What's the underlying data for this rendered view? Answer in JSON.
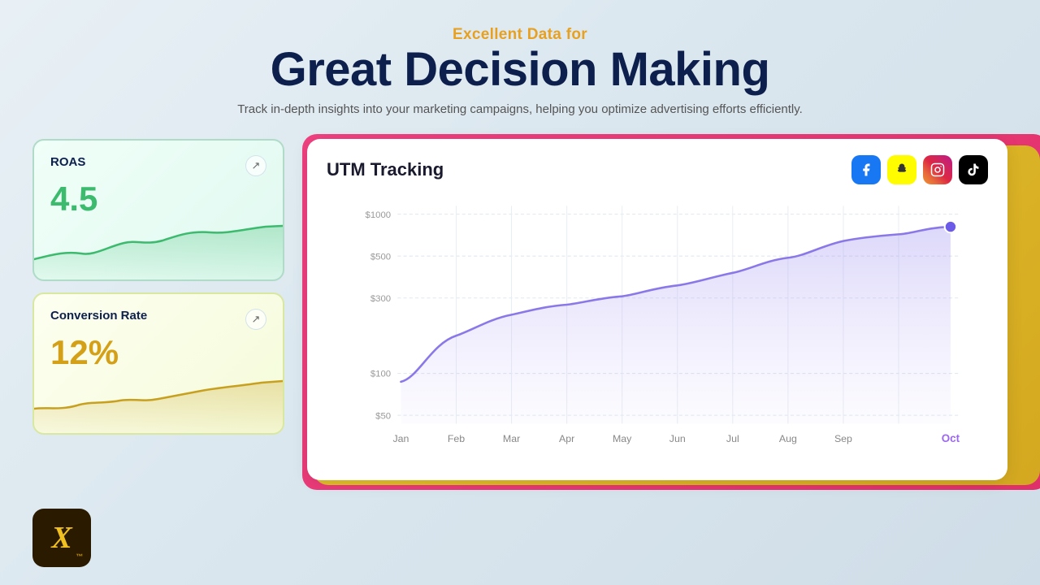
{
  "header": {
    "subtitle": "Excellent Data for",
    "title": "Great Decision Making",
    "description": "Track in-depth insights into your marketing campaigns, helping you optimize advertising efforts efficiently."
  },
  "roas_card": {
    "label": "ROAS",
    "value": "4.5",
    "arrow_label": "↗"
  },
  "conversion_card": {
    "label": "Conversion Rate",
    "value": "12%",
    "arrow_label": "↗"
  },
  "utm_card": {
    "title": "UTM Tracking",
    "social_icons": [
      "facebook",
      "snapchat",
      "instagram",
      "tiktok"
    ],
    "y_labels": [
      "$1000",
      "$500",
      "$300",
      "$100",
      "$50"
    ],
    "x_labels": [
      "Jan",
      "Feb",
      "Mar",
      "Apr",
      "May",
      "Jun",
      "Jul",
      "Aug",
      "Sep",
      "Oct"
    ]
  },
  "logo": {
    "text": "X"
  },
  "colors": {
    "accent_yellow": "#e8a020",
    "accent_green": "#3cba6e",
    "accent_gold": "#d4a017",
    "navy": "#0d1f4c",
    "chart_purple": "#7b68ee",
    "chart_fill": "rgba(123,104,238,0.15)"
  }
}
